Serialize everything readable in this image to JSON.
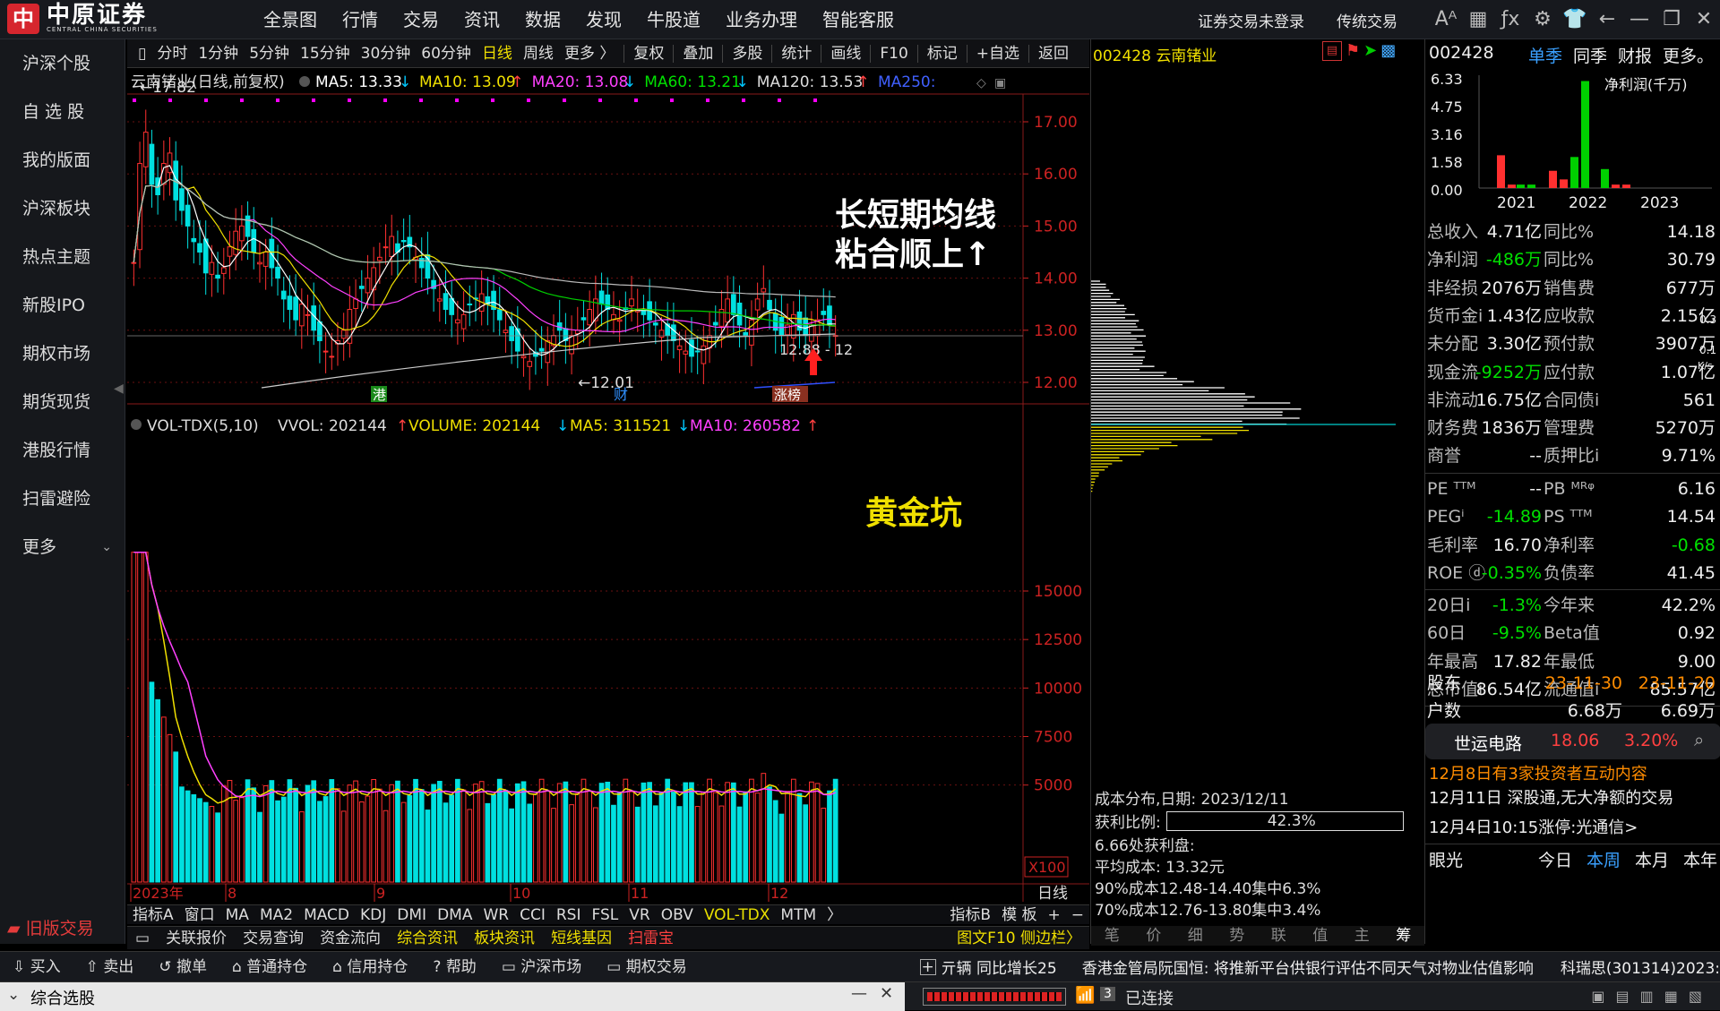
{
  "app": {
    "logo_char": "中",
    "logo_name": "中原证券",
    "logo_sub": "CENTRAL CHINA SECURITIES",
    "nav": [
      "全景图",
      "行情",
      "交易",
      "资讯",
      "数据",
      "发现",
      "牛股道",
      "业务办理",
      "智能客服"
    ],
    "login_status": "证券交易未登录",
    "trad_trade": "传统交易",
    "icons": [
      "font-size-icon",
      "layout-icon",
      "formula-icon",
      "settings-icon",
      "skin-icon",
      "back-icon",
      "restore-icon",
      "close-icon"
    ]
  },
  "leftnav": {
    "items": [
      "沪深个股",
      "自 选 股",
      "我的版面",
      "沪深板块",
      "热点主题",
      "新股IPO",
      "期权市场",
      "期货现货",
      "港股行情",
      "扫雷避险",
      "更多"
    ],
    "old_version": "旧版交易"
  },
  "periodbar": {
    "items": [
      "分时",
      "1分钟",
      "5分钟",
      "15分钟",
      "30分钟",
      "60分钟",
      "日线",
      "周线",
      "更多 〉"
    ],
    "active": "日线",
    "tools": [
      "复权",
      "叠加",
      "多股",
      "统计",
      "画线",
      "F10",
      "标记",
      "+自选",
      "返回"
    ]
  },
  "kline": {
    "title": "云南锗业(日线,前复权)",
    "ma_labels": [
      {
        "name": "MA5: 13.33",
        "arrow": "↓",
        "color": "#ffffff"
      },
      {
        "name": "MA10: 13.09",
        "arrow": "↑",
        "color": "#f0e000"
      },
      {
        "name": "MA20: 13.08",
        "arrow": "↓",
        "color": "#ff40ff"
      },
      {
        "name": "MA60: 13.21",
        "arrow": "↓",
        "color": "#00e000"
      },
      {
        "name": "MA120: 13.53",
        "arrow": "↑",
        "color": "#dddddd"
      },
      {
        "name": "MA250:",
        "arrow": "",
        "color": "#4060ff"
      }
    ],
    "y_ticks": [
      "17.00",
      "16.00",
      "15.00",
      "14.00",
      "13.00",
      "12.00"
    ],
    "high_label": "17.82",
    "low_label": "12.01",
    "cur_label": "12.88",
    "annotation": [
      "长短期均线",
      "粘合顺上↑"
    ],
    "markers": [
      "港",
      "财",
      "涨榜"
    ]
  },
  "volume": {
    "title": "VOL-TDX(5,10)",
    "vvol": "VVOL: 202144",
    "volume": "VOLUME: 202144",
    "ma5": "MA5: 311521",
    "ma10": "MA10: 260582",
    "y_ticks": [
      "15000",
      "12500",
      "10000",
      "7500",
      "5000"
    ],
    "unit": "X100",
    "annotation": "黄金坑",
    "x_labels": [
      "2023年",
      "8",
      "9",
      "10",
      "11",
      "12"
    ],
    "period": "日线"
  },
  "indicators": {
    "items": [
      "指标A",
      "窗口",
      "MA",
      "MA2",
      "MACD",
      "KDJ",
      "DMI",
      "DMA",
      "WR",
      "CCI",
      "RSI",
      "FSL",
      "VR",
      "OBV",
      "VOL-TDX",
      "MTM",
      "〉",
      "指标B",
      "模 板",
      "+",
      "−"
    ],
    "active": "VOL-TDX"
  },
  "funcbar": {
    "items": [
      {
        "label": "关联报价",
        "color": "#dddddd"
      },
      {
        "label": "交易查询",
        "color": "#dddddd"
      },
      {
        "label": "资金流向",
        "color": "#dddddd"
      },
      {
        "label": "综合资讯",
        "color": "#f0e000"
      },
      {
        "label": "板块资讯",
        "color": "#f0e000"
      },
      {
        "label": "短线基因",
        "color": "#f0e000"
      },
      {
        "label": "扫雷宝",
        "color": "#ff4040"
      }
    ],
    "right": "图文F10 侧边栏〉"
  },
  "dist": {
    "code": "002428",
    "name": "云南锗业",
    "title": "成本分布,日期: 2023/12/11",
    "profit_label": "获利比例:",
    "profit_value": "42.3%",
    "profit_pct": 42.3,
    "line1": "6.66处获利盘:",
    "line2": "平均成本: 13.32元",
    "line3": "90%成本12.48-14.40集中6.3%",
    "line4": "70%成本12.76-13.80集中3.4%",
    "tabs": [
      "笔",
      "价",
      "细",
      "势",
      "联",
      "值",
      "主",
      "筹"
    ],
    "active_tab": "筹"
  },
  "info": {
    "code": "002428",
    "tabs": [
      "单季",
      "同季",
      "财报",
      "更多。"
    ],
    "chart_title": "净利润(千万)",
    "chart_y": [
      "6.33",
      "4.75",
      "3.16",
      "1.58",
      "0.00"
    ],
    "chart_years": [
      "2021",
      "2022",
      "2023"
    ],
    "rows": [
      [
        "总收入",
        "4.71亿",
        "同比%",
        "14.18"
      ],
      [
        "净利润",
        "-486万",
        "同比%",
        "30.79"
      ],
      [
        "非经损",
        "2076万",
        "销售费",
        "677万"
      ],
      [
        "货币金i",
        "1.43亿",
        "应收款",
        "2.15亿"
      ],
      [
        "未分配",
        "3.30亿",
        "预付款",
        "3907万"
      ],
      [
        "现金流",
        "-9252万",
        "应付款",
        "1.07亿"
      ],
      [
        "非流动",
        "16.75亿",
        "合同债i",
        "561"
      ],
      [
        "财务费",
        "1836万",
        "管理费",
        "5270万"
      ],
      [
        "商誉",
        "--",
        "质押比i",
        "9.71%"
      ]
    ],
    "rows2": [
      [
        "PE ᵀᵀᴹ",
        "--",
        "PB ᴹᴿᵠ",
        "6.16"
      ],
      [
        "PEGⁱ",
        "-14.89",
        "PS ᵀᵀᴹ",
        "14.54"
      ],
      [
        "毛利率",
        "16.70",
        "净利率",
        "-0.68"
      ],
      [
        "ROE ⓓ",
        "-0.35%",
        "负债率",
        "41.45"
      ]
    ],
    "rows3": [
      [
        "20日i",
        "-1.3%",
        "今年来",
        "42.2%"
      ],
      [
        "60日",
        "-9.5%",
        "Beta值",
        "0.92"
      ],
      [
        "年最高",
        "17.82",
        "年最低",
        "9.00"
      ],
      [
        "总市值i",
        "86.54亿",
        "流通值i",
        "85.57亿"
      ]
    ],
    "holder_label": "股东",
    "holder_d1": "23-11-30",
    "holder_d2": "23-11-20",
    "households_label": "户数",
    "households_v1": "6.68万",
    "households_v2": "6.69万",
    "compare_label": "较",
    "popup_name": "世运电路",
    "popup_price": "18.06",
    "popup_pct": "3.20%",
    "news": [
      "12月8日有3家投资者互动内容",
      "12月11日 深股通,无大净额的交易",
      "12月4日10:15涨停:光通信>"
    ],
    "eye": "眼光",
    "periods": [
      "今日",
      "本周",
      "本月",
      "本年"
    ],
    "active_period": "本周",
    "speed1": "0.3",
    "speed2": "0.1",
    "speed_unit": "K/s"
  },
  "status": {
    "items": [
      "买入",
      "卖出",
      "撤单",
      "普通持仓",
      "信用持仓",
      "帮助",
      "沪深市场",
      "期权交易"
    ],
    "ticker1": "亓辆 同比增长25",
    "ticker2": "香港金管局阮国恒: 将推新平台供银行评估不同天气对物业估值影响",
    "ticker3": "科瑞思(301314)2023:"
  },
  "footer": {
    "title": "综合选股",
    "connection": "已连接",
    "conn_count": "3"
  }
}
